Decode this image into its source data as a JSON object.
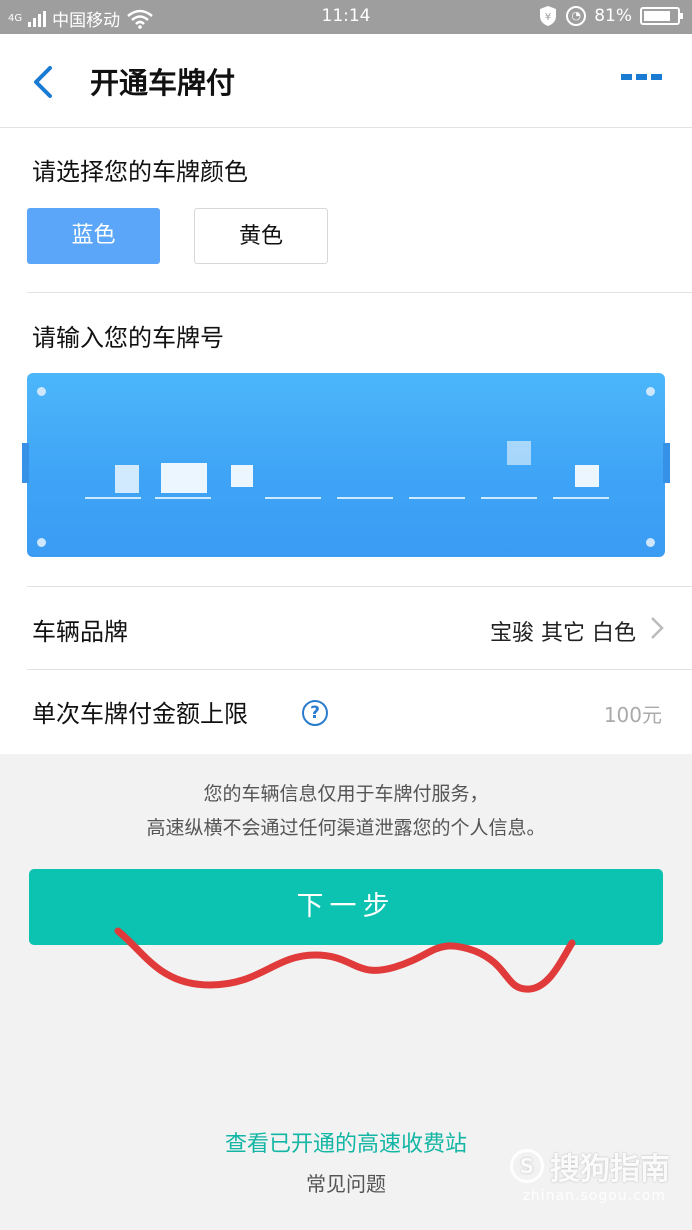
{
  "status_bar": {
    "network": "4G",
    "carrier": "中国移动",
    "time": "11:14",
    "battery": "81%",
    "battery_level": 0.81
  },
  "header": {
    "title": "开通车牌付"
  },
  "plate_color": {
    "label": "请选择您的车牌颜色",
    "options": [
      "蓝色",
      "黄色"
    ],
    "selected": "蓝色"
  },
  "plate_number": {
    "label": "请输入您的车牌号"
  },
  "vehicle": {
    "label": "车辆品牌",
    "value": "宝骏 其它 白色"
  },
  "limit": {
    "label": "单次车牌付金额上限",
    "value": "100元"
  },
  "notice": {
    "line1": "您的车辆信息仅用于车牌付服务，",
    "line2": "高速纵横不会通过任何渠道泄露您的个人信息。"
  },
  "next_button": "下一步",
  "links": {
    "stations": "查看已开通的高速收费站",
    "faq": "常见问题"
  },
  "watermark": {
    "brand": "搜狗指南",
    "url": "zhinan.sogou.com"
  },
  "colors": {
    "accent_blue": "#5ba6f8",
    "plate_blue": "#3fa4f6",
    "button_teal": "#0cc3b1",
    "link_teal": "#13b6a4",
    "scribble_red": "#e03a3a"
  }
}
